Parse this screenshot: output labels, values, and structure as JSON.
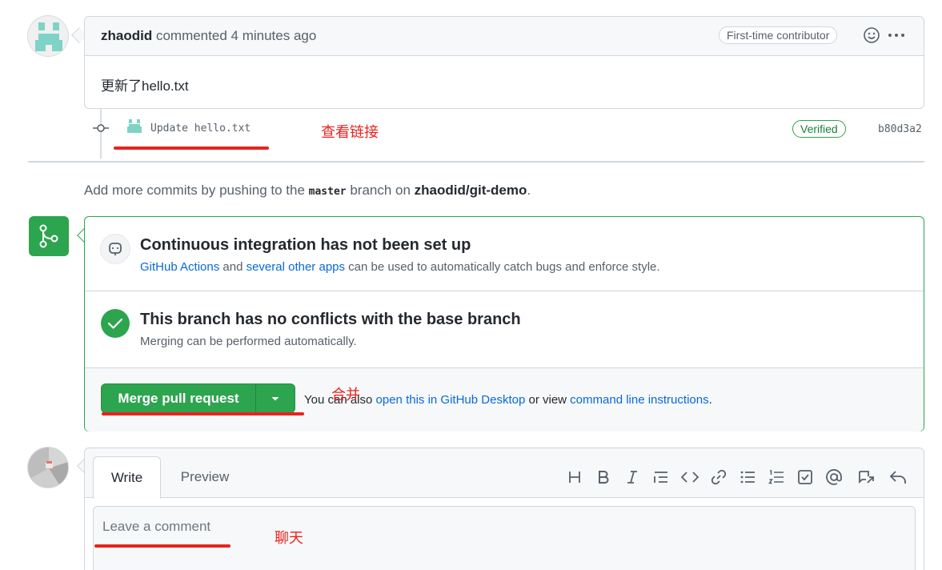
{
  "comment": {
    "author": "zhaodid",
    "action": "commented",
    "time": "4 minutes ago",
    "badge": "First-time contributor",
    "body": "更新了hello.txt"
  },
  "commit": {
    "message": "Update hello.txt",
    "verified": "Verified",
    "sha": "b80d3a2"
  },
  "annotations": {
    "view_link": "查看链接",
    "merge": "合并",
    "chat": "聊天"
  },
  "push_hint": {
    "prefix": "Add more commits by pushing to the ",
    "branch": "master",
    "middle": " branch on ",
    "repo": "zhaodid/git-demo",
    "suffix": "."
  },
  "merge_box": {
    "ci_title": "Continuous integration has not been set up",
    "ci_link1": "GitHub Actions",
    "ci_and": " and ",
    "ci_link2": "several other apps",
    "ci_rest": " can be used to automatically catch bugs and enforce style.",
    "conflict_title": "This branch has no conflicts with the base branch",
    "conflict_sub": "Merging can be performed automatically.",
    "merge_button": "Merge pull request",
    "alt_prefix": "You can also ",
    "alt_link1": "open this in GitHub Desktop",
    "alt_middle": " or view ",
    "alt_link2": "command line instructions",
    "alt_suffix": "."
  },
  "editor": {
    "tab_write": "Write",
    "tab_preview": "Preview",
    "placeholder": "Leave a comment",
    "tools": [
      "heading-icon",
      "bold-icon",
      "italic-icon",
      "quote-icon",
      "code-icon",
      "link-icon",
      "unordered-list-icon",
      "ordered-list-icon",
      "task-list-icon",
      "mention-icon",
      "reference-icon",
      "reply-icon"
    ]
  },
  "colors": {
    "green": "#2da44e",
    "annotation_red": "#e8231e",
    "link_blue": "#0969da",
    "identicon": "#7fd3c6"
  }
}
